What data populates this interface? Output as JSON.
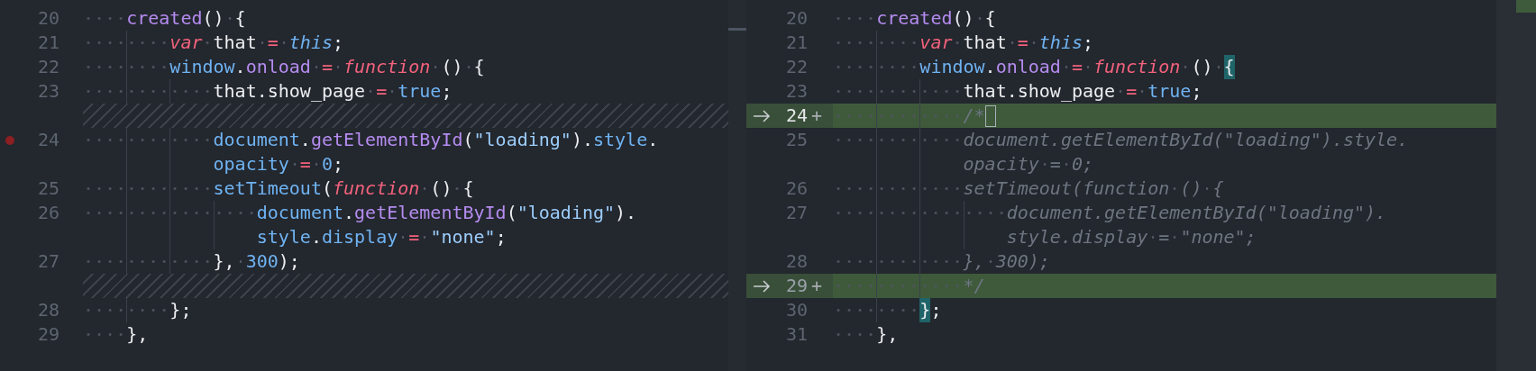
{
  "panes": [
    {
      "lines": [
        {
          "kind": "code",
          "number": "20",
          "breakpoint": false,
          "rows": [
            {
              "tokens": [
                {
                  "text": "    created",
                  "kind": "fn"
                },
                {
                  "text": "() {",
                  "kind": "punc"
                }
              ]
            }
          ]
        },
        {
          "kind": "code",
          "number": "21",
          "breakpoint": false,
          "rows": [
            {
              "tokens": [
                {
                  "text": "        var",
                  "kind": "kw"
                },
                {
                  "text": " that ",
                  "kind": "plain"
                },
                {
                  "text": "= ",
                  "kind": "op"
                },
                {
                  "text": "this",
                  "kind": "lang"
                },
                {
                  "text": ";",
                  "kind": "punc"
                }
              ]
            }
          ]
        },
        {
          "kind": "code",
          "number": "22",
          "breakpoint": false,
          "rows": [
            {
              "tokens": [
                {
                  "text": "        window",
                  "kind": "prop"
                },
                {
                  "text": ".",
                  "kind": "punc"
                },
                {
                  "text": "onload",
                  "kind": "fn"
                },
                {
                  "text": " = ",
                  "kind": "op"
                },
                {
                  "text": "function",
                  "kind": "kw"
                },
                {
                  "text": " () {",
                  "kind": "punc"
                }
              ]
            }
          ]
        },
        {
          "kind": "code",
          "number": "23",
          "breakpoint": false,
          "rows": [
            {
              "tokens": [
                {
                  "text": "            that.show_page ",
                  "kind": "plain"
                },
                {
                  "text": "= ",
                  "kind": "op"
                },
                {
                  "text": "true",
                  "kind": "num"
                },
                {
                  "text": ";",
                  "kind": "punc"
                }
              ]
            }
          ]
        },
        {
          "kind": "filler"
        },
        {
          "kind": "code",
          "number": "24",
          "breakpoint": true,
          "rows": [
            {
              "tokens": [
                {
                  "text": "            document",
                  "kind": "prop"
                },
                {
                  "text": ".",
                  "kind": "punc"
                },
                {
                  "text": "getElementById",
                  "kind": "fn"
                },
                {
                  "text": "(",
                  "kind": "punc"
                },
                {
                  "text": "\"loading\"",
                  "kind": "str"
                },
                {
                  "text": ").",
                  "kind": "punc"
                },
                {
                  "text": "style",
                  "kind": "prop"
                },
                {
                  "text": ".",
                  "kind": "punc"
                }
              ]
            },
            {
              "tokens": [
                {
                  "text": "opacity",
                  "kind": "prop"
                },
                {
                  "text": " = ",
                  "kind": "op"
                },
                {
                  "text": "0",
                  "kind": "num"
                },
                {
                  "text": ";",
                  "kind": "punc"
                }
              ]
            }
          ]
        },
        {
          "kind": "code",
          "number": "25",
          "breakpoint": false,
          "rows": [
            {
              "tokens": [
                {
                  "text": "            setTimeout",
                  "kind": "prop"
                },
                {
                  "text": "(",
                  "kind": "punc"
                },
                {
                  "text": "function",
                  "kind": "kw"
                },
                {
                  "text": " () {",
                  "kind": "punc"
                }
              ]
            }
          ]
        },
        {
          "kind": "code",
          "number": "26",
          "breakpoint": false,
          "rows": [
            {
              "tokens": [
                {
                  "text": "                document",
                  "kind": "prop"
                },
                {
                  "text": ".",
                  "kind": "punc"
                },
                {
                  "text": "getElementById",
                  "kind": "fn"
                },
                {
                  "text": "(",
                  "kind": "punc"
                },
                {
                  "text": "\"loading\"",
                  "kind": "str"
                },
                {
                  "text": ").",
                  "kind": "punc"
                }
              ]
            },
            {
              "tokens": [
                {
                  "text": "style",
                  "kind": "prop"
                },
                {
                  "text": ".",
                  "kind": "punc"
                },
                {
                  "text": "display",
                  "kind": "prop"
                },
                {
                  "text": " = ",
                  "kind": "op"
                },
                {
                  "text": "\"none\"",
                  "kind": "str"
                },
                {
                  "text": ";",
                  "kind": "punc"
                }
              ]
            }
          ]
        },
        {
          "kind": "code",
          "number": "27",
          "breakpoint": false,
          "rows": [
            {
              "tokens": [
                {
                  "text": "            }, ",
                  "kind": "punc"
                },
                {
                  "text": "300",
                  "kind": "num"
                },
                {
                  "text": ");",
                  "kind": "punc"
                }
              ]
            }
          ]
        },
        {
          "kind": "filler"
        },
        {
          "kind": "code",
          "number": "28",
          "breakpoint": false,
          "rows": [
            {
              "tokens": [
                {
                  "text": "        };",
                  "kind": "punc"
                }
              ]
            }
          ]
        },
        {
          "kind": "code",
          "number": "29",
          "breakpoint": false,
          "rows": [
            {
              "tokens": [
                {
                  "text": "    },",
                  "kind": "punc"
                }
              ]
            }
          ]
        }
      ]
    },
    {
      "lines": [
        {
          "kind": "code",
          "number": "20",
          "current": false,
          "rows": [
            {
              "tokens": [
                {
                  "text": "    created",
                  "kind": "fn"
                },
                {
                  "text": "() {",
                  "kind": "punc"
                }
              ]
            }
          ]
        },
        {
          "kind": "code",
          "number": "21",
          "current": false,
          "rows": [
            {
              "tokens": [
                {
                  "text": "        var",
                  "kind": "kw"
                },
                {
                  "text": " that ",
                  "kind": "plain"
                },
                {
                  "text": "= ",
                  "kind": "op"
                },
                {
                  "text": "this",
                  "kind": "lang"
                },
                {
                  "text": ";",
                  "kind": "punc"
                }
              ]
            }
          ]
        },
        {
          "kind": "code",
          "number": "22",
          "current": false,
          "rows": [
            {
              "tokens": [
                {
                  "text": "        window",
                  "kind": "prop"
                },
                {
                  "text": ".",
                  "kind": "punc"
                },
                {
                  "text": "onload",
                  "kind": "fn"
                },
                {
                  "text": " = ",
                  "kind": "op"
                },
                {
                  "text": "function",
                  "kind": "kw"
                },
                {
                  "text": " () ",
                  "kind": "punc"
                },
                {
                  "text": "{",
                  "kind": "bracket"
                }
              ]
            }
          ]
        },
        {
          "kind": "code",
          "number": "23",
          "current": false,
          "rows": [
            {
              "tokens": [
                {
                  "text": "            that.show_page ",
                  "kind": "plain"
                },
                {
                  "text": "= ",
                  "kind": "op"
                },
                {
                  "text": "true",
                  "kind": "num"
                },
                {
                  "text": ";",
                  "kind": "punc"
                }
              ]
            }
          ]
        },
        {
          "kind": "added",
          "number": "24",
          "marker": "+",
          "current": true,
          "rows": [
            {
              "tokens": [
                {
                  "text": "            /*",
                  "kind": "comment"
                }
              ]
            }
          ]
        },
        {
          "kind": "code",
          "number": "25",
          "current": false,
          "rows": [
            {
              "tokens": [
                {
                  "text": "            document.getElementById(\"loading\").style.",
                  "kind": "comment"
                }
              ]
            },
            {
              "tokens": [
                {
                  "text": "opacity = 0;",
                  "kind": "comment"
                }
              ]
            }
          ]
        },
        {
          "kind": "code",
          "number": "26",
          "current": false,
          "rows": [
            {
              "tokens": [
                {
                  "text": "            setTimeout(function () {",
                  "kind": "comment"
                }
              ]
            }
          ]
        },
        {
          "kind": "code",
          "number": "27",
          "current": false,
          "rows": [
            {
              "tokens": [
                {
                  "text": "                document.getElementById(\"loading\").",
                  "kind": "comment"
                }
              ]
            },
            {
              "tokens": [
                {
                  "text": "style.display = \"none\";",
                  "kind": "comment"
                }
              ]
            }
          ]
        },
        {
          "kind": "code",
          "number": "28",
          "current": false,
          "rows": [
            {
              "tokens": [
                {
                  "text": "            }, 300);",
                  "kind": "comment"
                }
              ]
            }
          ]
        },
        {
          "kind": "added",
          "number": "29",
          "marker": "+",
          "current": false,
          "rows": [
            {
              "tokens": [
                {
                  "text": "            */",
                  "kind": "comment"
                }
              ]
            }
          ]
        },
        {
          "kind": "code",
          "number": "30",
          "current": false,
          "rows": [
            {
              "tokens": [
                {
                  "text": "        }",
                  "kind": "bracket"
                },
                {
                  "text": ";",
                  "kind": "punc"
                }
              ]
            }
          ]
        },
        {
          "kind": "code",
          "number": "31",
          "current": false,
          "rows": [
            {
              "tokens": [
                {
                  "text": "    },",
                  "kind": "punc"
                }
              ]
            }
          ]
        }
      ]
    }
  ]
}
